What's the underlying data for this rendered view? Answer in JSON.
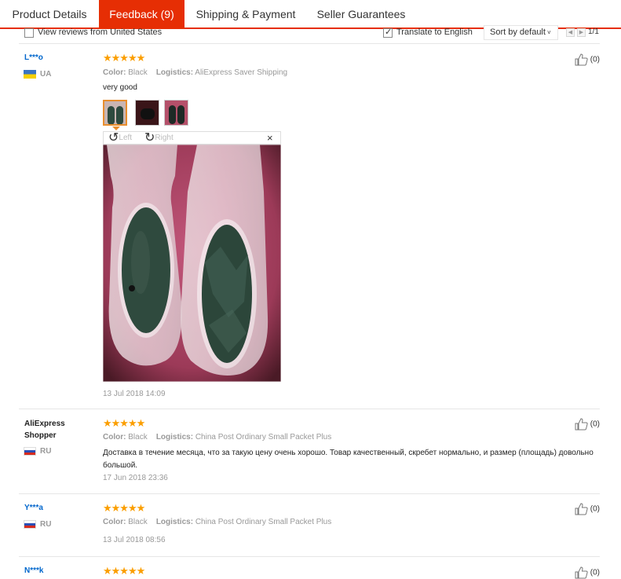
{
  "tabs": [
    {
      "label": "Product Details"
    },
    {
      "label": "Feedback (9)"
    },
    {
      "label": "Shipping & Payment"
    },
    {
      "label": "Seller Guarantees"
    }
  ],
  "filters": {
    "view_us_label": "View reviews from United States",
    "translate_label": "Translate to English",
    "sort_value": "Sort by default",
    "pager_text": "1/1"
  },
  "viewer": {
    "left_label": "Left",
    "right_label": "Right",
    "close_symbol": "×"
  },
  "reviews": [
    {
      "user": "L***o",
      "country": "UA",
      "stars": "★★★★★",
      "color_label": "Color:",
      "color_value": "Black",
      "logistics_label": "Logistics:",
      "logistics_value": "AliExpress Saver Shipping",
      "text": "very good",
      "date": "13 Jul 2018 14:09",
      "helpful": "(0)"
    },
    {
      "user": "AliExpress Shopper",
      "country": "RU",
      "stars": "★★★★★",
      "color_label": "Color:",
      "color_value": "Black",
      "logistics_label": "Logistics:",
      "logistics_value": "China Post Ordinary Small Packet Plus",
      "text": "Доставка в течение месяца, что за такую цену очень хорошо. Товар качественный, скребет нормально, и размер (площадь) довольно большой.",
      "date": "17 Jun 2018 23:36",
      "helpful": "(0)"
    },
    {
      "user": "Y***a",
      "country": "RU",
      "stars": "★★★★★",
      "color_label": "Color:",
      "color_value": "Black",
      "logistics_label": "Logistics:",
      "logistics_value": "China Post Ordinary Small Packet Plus",
      "date": "13 Jul 2018 08:56",
      "helpful": "(0)"
    },
    {
      "user": "N***k",
      "stars": "★★★★★",
      "helpful": "(0)"
    }
  ],
  "colors": {
    "accent": "#e62e04",
    "star": "#fb9e00",
    "username": "#0066cc"
  }
}
